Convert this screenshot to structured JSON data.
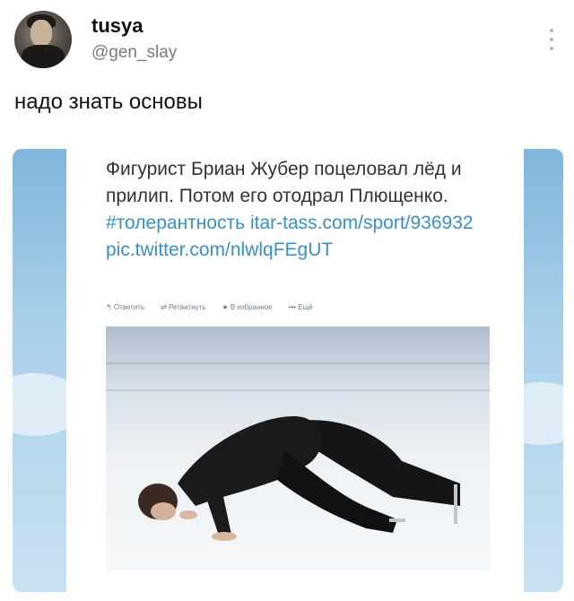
{
  "tweet": {
    "display_name": "tusya",
    "handle": "@gen_slay",
    "text": "надо знать основы"
  },
  "embedded_tweet": {
    "text_plain": "Фигурист Бриан Жубер поцеловал лёд и прилип. Потом его отодрал Плющенко. ",
    "hashtag": "#толерантность",
    "link1": "itar-tass.com/sport/936932",
    "link2": "pic.twitter.com/nlwlqFEgUT",
    "actions": {
      "reply": "↰ Ответить",
      "retweet": "⇄ Ретвитнуть",
      "favorite": "★ В избранное",
      "more": "••• Ещё"
    }
  },
  "colors": {
    "link": "#3a8fc8",
    "handle": "#7a7a7a",
    "background": "#ffffff"
  },
  "icons": {
    "more": "more-options-icon"
  }
}
